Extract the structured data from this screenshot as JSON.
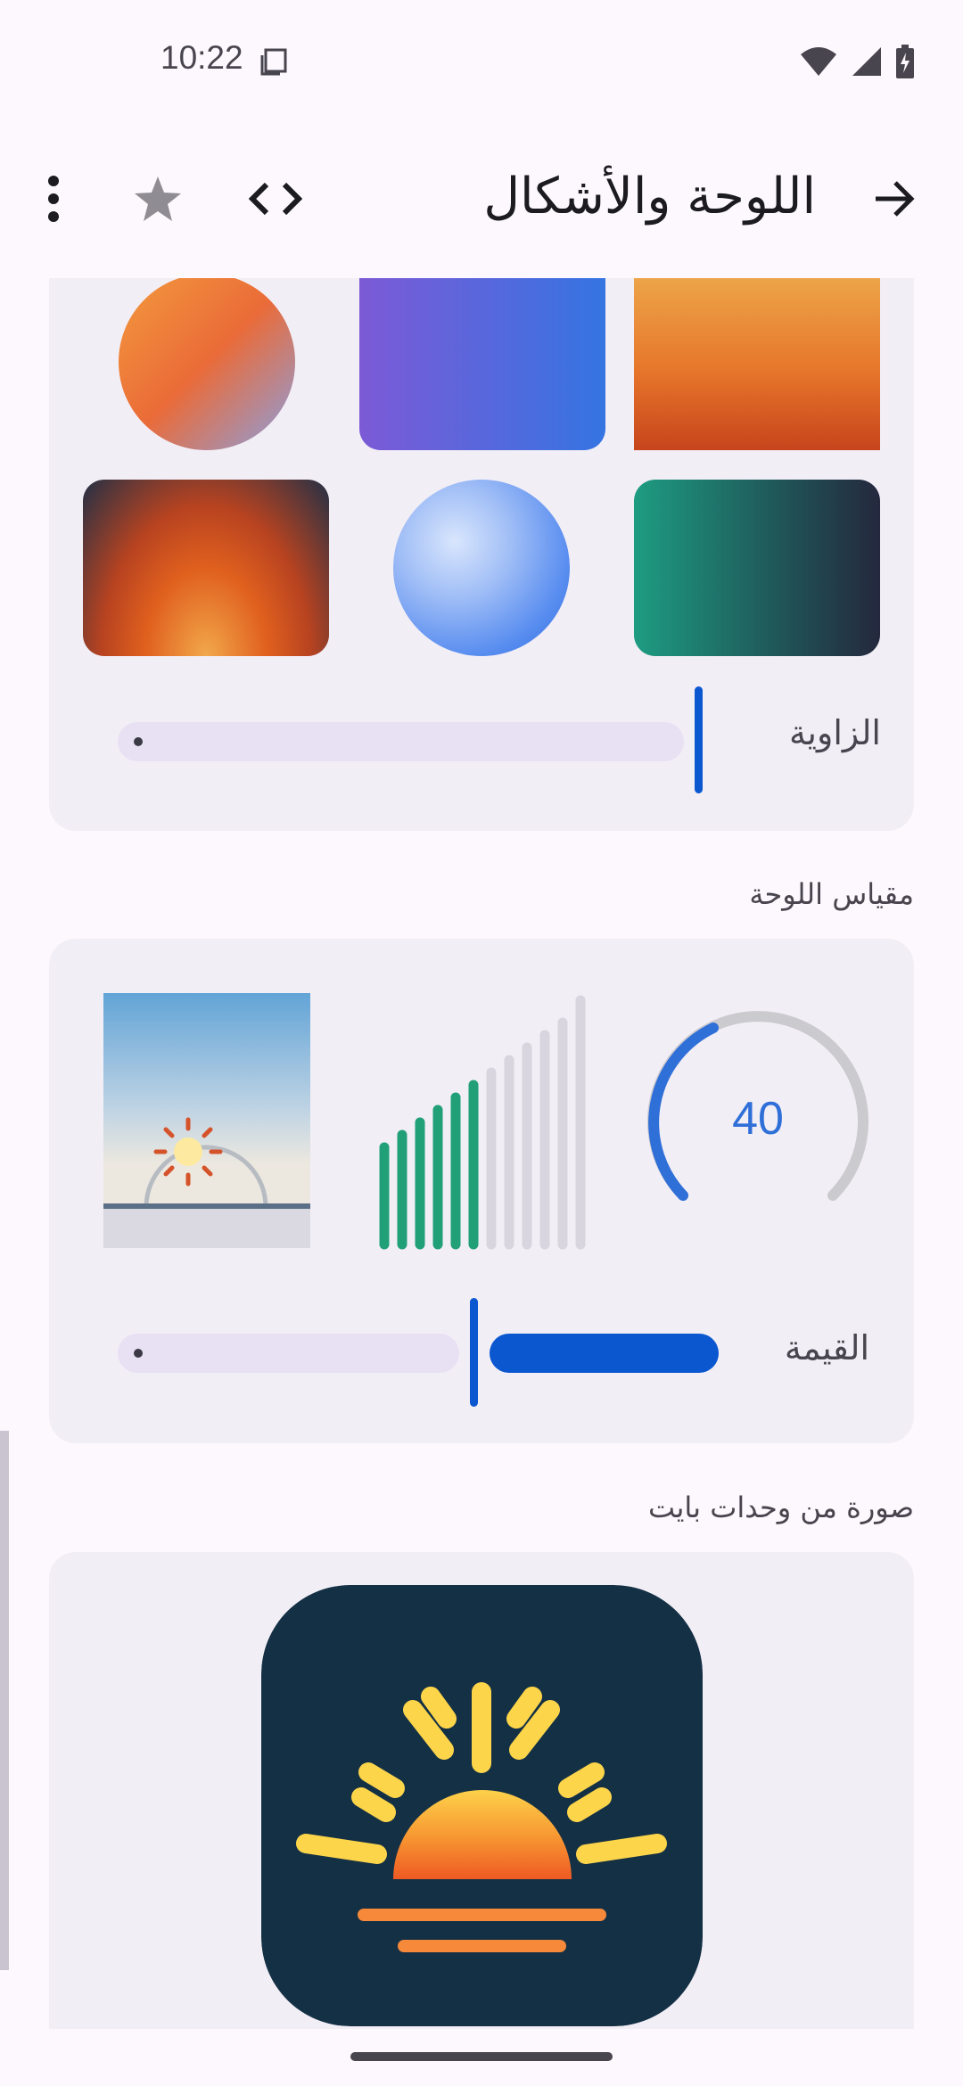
{
  "status_bar": {
    "time": "10:22",
    "icons": [
      "screenshot-icon",
      "wifi-icon",
      "signal-icon",
      "battery-charging-icon"
    ]
  },
  "top_bar": {
    "title": "اللوحة والأشكال",
    "back_icon": "arrow-forward-icon",
    "code_icon": "code-icon",
    "favorite_icon": "star-icon",
    "more_icon": "more-vert-icon"
  },
  "gradients_card": {
    "angle_label": "الزاوية",
    "angle_slider_value": 1.0
  },
  "canvas_gauge_section": {
    "label": "مقياس اللوحة",
    "gauge_value": "40",
    "bars_active": 6,
    "bars_total": 12,
    "value_label": "القيمة",
    "value_slider_fraction": 0.4
  },
  "byte_image_section": {
    "label": "صورة من وحدات بايت"
  },
  "colors": {
    "accent": "#0b57d0",
    "gauge_arc": "#2f6fd8",
    "bar_active": "#21a078",
    "bar_inactive": "#d8d5de",
    "icon_bg": "#143045",
    "sun_yellow": "#fdd54a",
    "sun_orange": "#f0612a"
  }
}
